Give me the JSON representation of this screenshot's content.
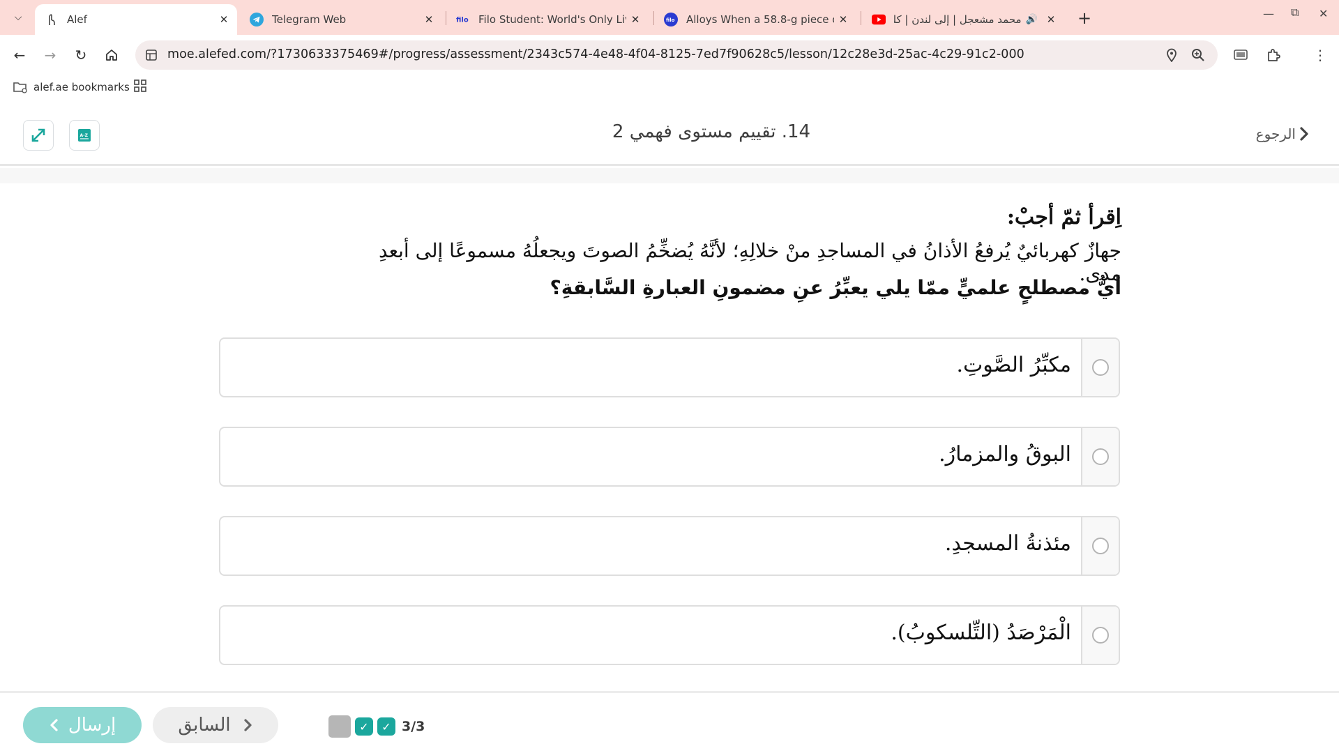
{
  "browser": {
    "tabs": [
      {
        "title": "Alef",
        "active": true
      },
      {
        "title": "Telegram Web"
      },
      {
        "title": "Filo Student: World's Only Live I"
      },
      {
        "title": "Alloys When a 58.8-g piece of h"
      },
      {
        "title": "محمد مشعجل | إلى لندن | كلما"
      }
    ],
    "url": "moe.alefed.com/?1730633375469#/progress/assessment/2343c574-4e48-4f04-8125-7ed7f90628c5/lesson/12c28e3d-25ac-4c29-91c2-000000059717/material/cc25b897-19ec-4...",
    "bookmarks": {
      "folder_label": "alef.ae bookmarks"
    }
  },
  "header": {
    "lesson_title": "14. تقييم مستوى فهمي 2",
    "back_label": "الرجوع"
  },
  "question": {
    "heading": "اِقرأ ثمّ أجبْ:",
    "passage": "جهازٌ كهربائيٌ يُرفعُ الأذانُ في المساجدِ منْ خلالِهِ؛ لأنَّهُ  يُضخِّمُ الصوتَ ويجعلُهُ مسموعًا إلى أبعدِ مدى.",
    "prompt": "أيُّ مصطلحٍ علميٍّ ممّا يلي يعبِّرُ عنِ مضمونِ العبارةِ السَّابقةِ؟",
    "options": [
      {
        "label": "مكبِّرُ الصَّوتِ."
      },
      {
        "label": "البوقُ والمزمارُ."
      },
      {
        "label": "مئذنةُ المسجدِ."
      },
      {
        "label": "الْمَرْصَدُ (التِّلسكوبُ)."
      }
    ]
  },
  "footer": {
    "send_label": "إرسال",
    "prev_label": "السابق",
    "progress_text": "3/3"
  },
  "colors": {
    "accent": "#1ba79d",
    "send_button": "#8fd9d3",
    "tabbar": "#fcdcd8"
  }
}
